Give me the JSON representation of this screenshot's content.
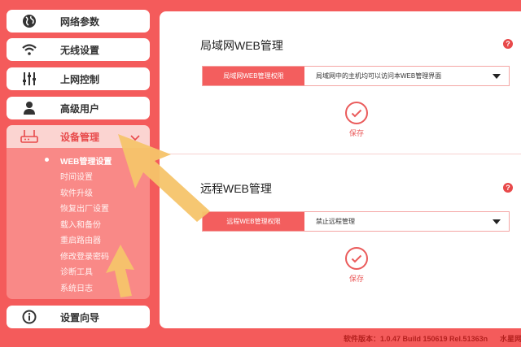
{
  "sidebar": {
    "items": [
      {
        "label": "网络参数",
        "icon": "globe-icon"
      },
      {
        "label": "无线设置",
        "icon": "wifi-icon"
      },
      {
        "label": "上网控制",
        "icon": "sliders-icon"
      },
      {
        "label": "高级用户",
        "icon": "user-icon"
      },
      {
        "label": "设备管理",
        "icon": "router-icon",
        "active": true
      },
      {
        "label": "设置向导",
        "icon": "info-icon"
      }
    ],
    "submenu": [
      "WEB管理设置",
      "时间设置",
      "软件升级",
      "恢复出厂设置",
      "载入和备份",
      "重启路由器",
      "修改登录密码",
      "诊断工具",
      "系统日志"
    ]
  },
  "main": {
    "lan": {
      "title": "局域网WEB管理",
      "key": "局域网WEB管理权限",
      "value": "局域网中的主机均可以访问本WEB管理界面",
      "save": "保存"
    },
    "remote": {
      "title": "远程WEB管理",
      "key": "远程WEB管理权限",
      "value": "禁止远程管理",
      "save": "保存"
    },
    "help_glyph": "?"
  },
  "footer": {
    "version": "软件版本：1.0.47 Build 150619 Rel.51363n",
    "brand": "水星网"
  },
  "colors": {
    "accent": "#f45b5b",
    "highlight": "#f6c46a"
  }
}
